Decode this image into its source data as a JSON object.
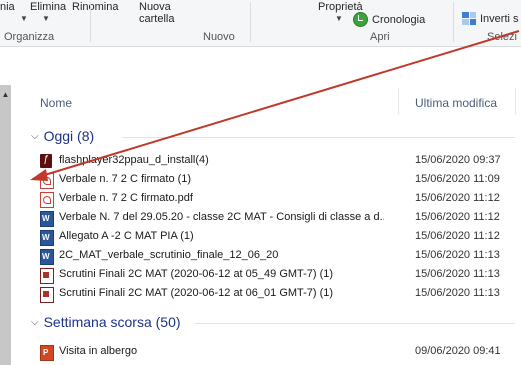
{
  "ribbon": {
    "top_left_1": "nia",
    "elimina": "Elimina",
    "rinomina": "Rinomina",
    "nuova": "Nuova",
    "cartella": "cartella",
    "proprieta": "Proprietà",
    "cronologia": "Cronologia",
    "inverti": "Inverti s",
    "groups": {
      "organizza": "Organizza",
      "nuovo": "Nuovo",
      "apri": "Apri",
      "seleziona": "Selezi"
    }
  },
  "columns": {
    "nome": "Nome",
    "ultima_modifica": "Ultima modifica"
  },
  "groups": [
    {
      "label": "Oggi (8)"
    },
    {
      "label": "Settimana scorsa (50)"
    }
  ],
  "files_today": [
    {
      "name": "flashplayer32ppau_d_install(4)",
      "date": "15/06/2020 09:37",
      "icon": "flash-icon"
    },
    {
      "name": "Verbale n. 7  2 C firmato (1)",
      "date": "15/06/2020 11:09",
      "icon": "pdf-icon"
    },
    {
      "name": "Verbale n. 7  2 C firmato.pdf",
      "date": "15/06/2020 11:12",
      "icon": "pdf-icon"
    },
    {
      "name": "Verbale N. 7 del 29.05.20 - classe 2C MAT - Consigli di classe a d...",
      "date": "15/06/2020 11:12",
      "icon": "word-icon"
    },
    {
      "name": "Allegato A -2 C MAT  PIA (1)",
      "date": "15/06/2020 11:12",
      "icon": "word-icon"
    },
    {
      "name": "2C_MAT_verbale_scrutinio_finale_12_06_20",
      "date": "15/06/2020 11:13",
      "icon": "word-icon"
    },
    {
      "name": "Scrutini Finali 2C MAT (2020-06-12 at 05_49 GMT-7) (1)",
      "date": "15/06/2020 11:13",
      "icon": "video-icon"
    },
    {
      "name": "Scrutini Finali 2C MAT (2020-06-12 at 06_01 GMT-7) (1)",
      "date": "15/06/2020 11:13",
      "icon": "video-icon"
    }
  ],
  "files_last_week": [
    {
      "name": "Visita in albergo",
      "date": "09/06/2020 09:41",
      "icon": "ppt-icon"
    }
  ],
  "colors": {
    "group_header": "#1e3287",
    "annotation_arrow": "#c0392b"
  }
}
